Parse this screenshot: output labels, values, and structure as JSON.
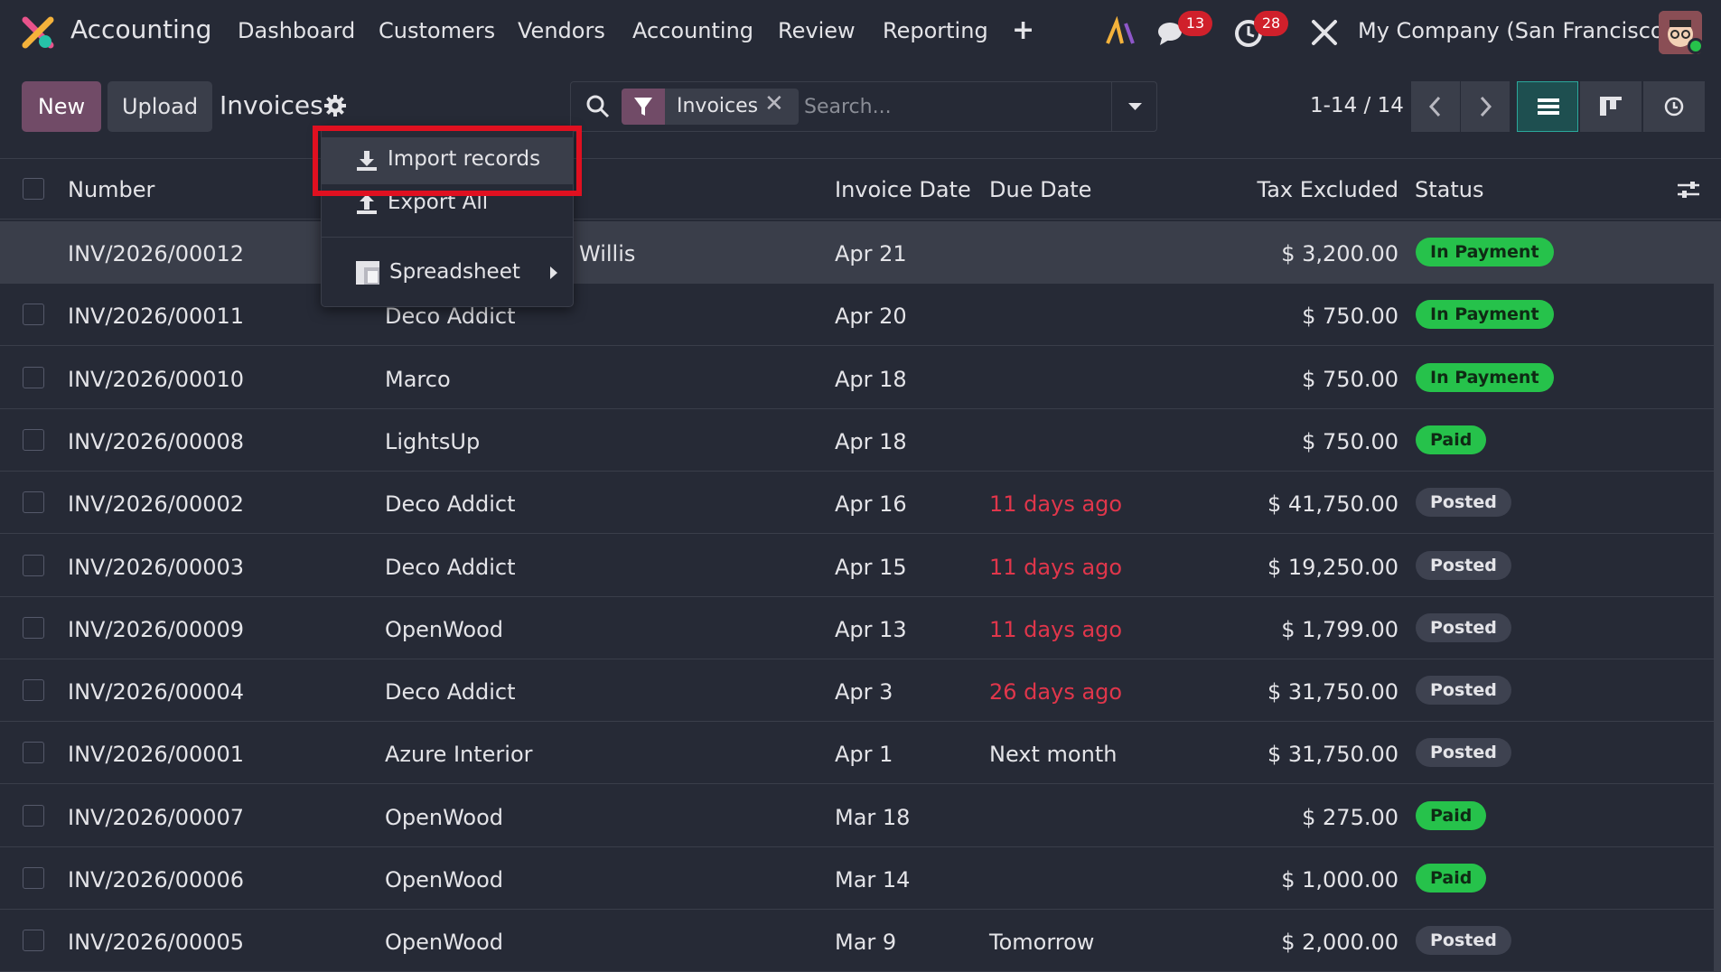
{
  "nav": {
    "app_name": "Accounting",
    "menu": [
      "Dashboard",
      "Customers",
      "Vendors",
      "Accounting",
      "Review",
      "Reporting"
    ],
    "messages_count": "13",
    "activities_count": "28",
    "company": "My Company (San Francisco)"
  },
  "control": {
    "new_label": "New",
    "upload_label": "Upload",
    "breadcrumb": "Invoices",
    "facet_label": "Invoices",
    "search_placeholder": "Search...",
    "pager": "1-14 / 14"
  },
  "table": {
    "headers": {
      "number": "Number",
      "invoice_date": "Invoice Date",
      "due_date": "Due Date",
      "tax_excluded": "Tax Excluded",
      "status": "Status"
    },
    "rows": [
      {
        "number": "INV/2026/00012",
        "partner": "Willis",
        "date": "Apr 21",
        "due": "",
        "due_overdue": false,
        "amount": "$ 3,200.00",
        "status": "In Payment",
        "status_kind": "green"
      },
      {
        "number": "INV/2026/00011",
        "partner": "Deco Addict",
        "date": "Apr 20",
        "due": "",
        "due_overdue": false,
        "amount": "$ 750.00",
        "status": "In Payment",
        "status_kind": "green"
      },
      {
        "number": "INV/2026/00010",
        "partner": "Marco",
        "date": "Apr 18",
        "due": "",
        "due_overdue": false,
        "amount": "$ 750.00",
        "status": "In Payment",
        "status_kind": "green"
      },
      {
        "number": "INV/2026/00008",
        "partner": "LightsUp",
        "date": "Apr 18",
        "due": "",
        "due_overdue": false,
        "amount": "$ 750.00",
        "status": "Paid",
        "status_kind": "green"
      },
      {
        "number": "INV/2026/00002",
        "partner": "Deco Addict",
        "date": "Apr 16",
        "due": "11 days ago",
        "due_overdue": true,
        "amount": "$ 41,750.00",
        "status": "Posted",
        "status_kind": "gray"
      },
      {
        "number": "INV/2026/00003",
        "partner": "Deco Addict",
        "date": "Apr 15",
        "due": "11 days ago",
        "due_overdue": true,
        "amount": "$ 19,250.00",
        "status": "Posted",
        "status_kind": "gray"
      },
      {
        "number": "INV/2026/00009",
        "partner": "OpenWood",
        "date": "Apr 13",
        "due": "11 days ago",
        "due_overdue": true,
        "amount": "$ 1,799.00",
        "status": "Posted",
        "status_kind": "gray"
      },
      {
        "number": "INV/2026/00004",
        "partner": "Deco Addict",
        "date": "Apr 3",
        "due": "26 days ago",
        "due_overdue": true,
        "amount": "$ 31,750.00",
        "status": "Posted",
        "status_kind": "gray"
      },
      {
        "number": "INV/2026/00001",
        "partner": "Azure Interior",
        "date": "Apr 1",
        "due": "Next month",
        "due_overdue": false,
        "amount": "$ 31,750.00",
        "status": "Posted",
        "status_kind": "gray"
      },
      {
        "number": "INV/2026/00007",
        "partner": "OpenWood",
        "date": "Mar 18",
        "due": "",
        "due_overdue": false,
        "amount": "$ 275.00",
        "status": "Paid",
        "status_kind": "green"
      },
      {
        "number": "INV/2026/00006",
        "partner": "OpenWood",
        "date": "Mar 14",
        "due": "",
        "due_overdue": false,
        "amount": "$ 1,000.00",
        "status": "Paid",
        "status_kind": "green"
      },
      {
        "number": "INV/2026/00005",
        "partner": "OpenWood",
        "date": "Mar 9",
        "due": "Tomorrow",
        "due_overdue": false,
        "amount": "$ 2,000.00",
        "status": "Posted",
        "status_kind": "gray"
      }
    ]
  },
  "dropdown": {
    "import": "Import records",
    "export": "Export All",
    "spreadsheet": "Spreadsheet"
  },
  "colors": {
    "background": "#262A36",
    "accent": "#714B67",
    "paid_green": "#26C24B",
    "overdue_red": "#E0364B",
    "highlight_red": "#E01020"
  }
}
